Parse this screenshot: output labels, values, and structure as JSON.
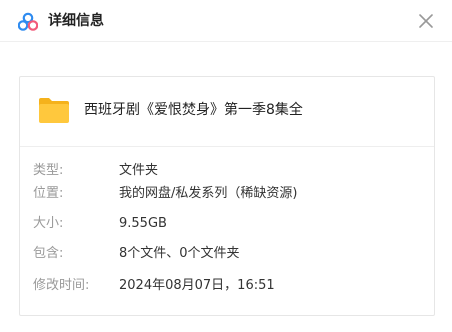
{
  "window": {
    "title": "详细信息"
  },
  "file": {
    "name": "西班牙剧《爱恨焚身》第一季8集全"
  },
  "details": [
    {
      "label": "类型:",
      "value": "文件夹"
    },
    {
      "label": "位置:",
      "value": "我的网盘/私发系列（稀缺资源)"
    },
    {
      "label": "大小:",
      "value": "9.55GB"
    },
    {
      "label": "包含:",
      "value": "8个文件、0个文件夹"
    },
    {
      "label": "修改时间:",
      "value": "2024年08月07日，16:51"
    }
  ],
  "icons": {
    "logo": "cloud-logo-icon",
    "close": "close-icon",
    "folder": "folder-icon"
  },
  "colors": {
    "folder": "#FFC83D",
    "folder_back": "#F5B21C",
    "logo_blue": "#2E8BF0",
    "logo_pink": "#F25A7A"
  }
}
